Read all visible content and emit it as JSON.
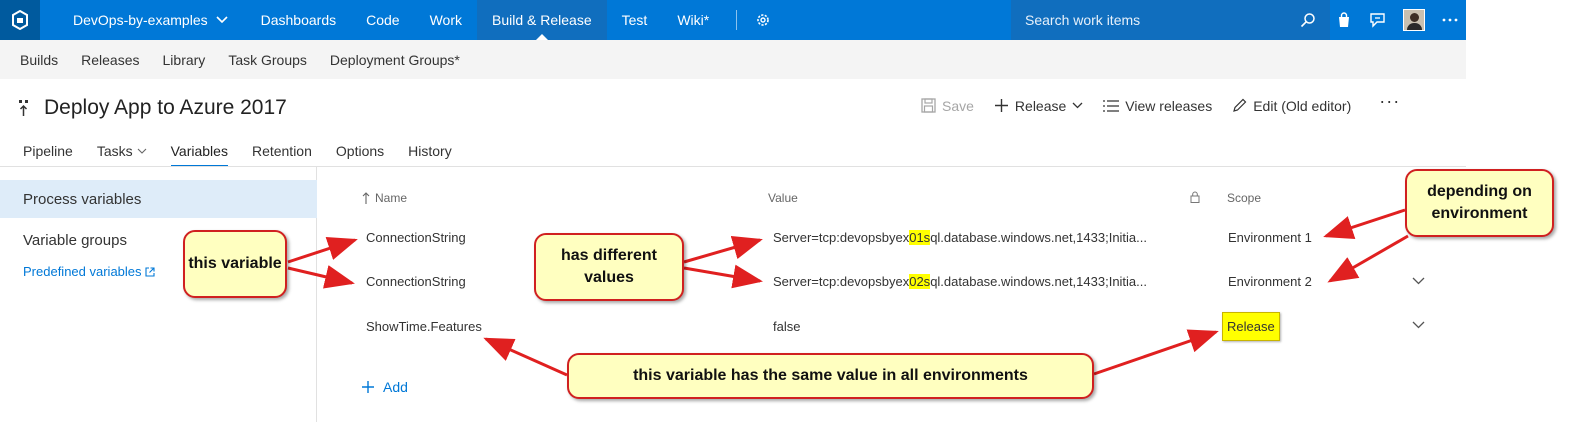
{
  "topbar": {
    "project": "DevOps-by-examples",
    "nav": [
      "Dashboards",
      "Code",
      "Work",
      "Build & Release",
      "Test",
      "Wiki*"
    ],
    "search_placeholder": "Search work items"
  },
  "subnav": [
    "Builds",
    "Releases",
    "Library",
    "Task Groups",
    "Deployment Groups*"
  ],
  "header": {
    "title": "Deploy App to Azure 2017",
    "save": "Save",
    "release": "Release",
    "view_releases": "View releases",
    "edit": "Edit (Old editor)",
    "more": "···"
  },
  "tabs": [
    "Pipeline",
    "Tasks",
    "Variables",
    "Retention",
    "Options",
    "History"
  ],
  "left": {
    "process_variables": "Process variables",
    "variable_groups": "Variable groups",
    "predefined": "Predefined variables"
  },
  "grid": {
    "col_name": "Name",
    "col_value": "Value",
    "col_scope": "Scope",
    "rows": [
      {
        "name": "ConnectionString",
        "value_pre": "Server=tcp:devopsbyex",
        "value_hl": "01s",
        "value_post": "ql.database.windows.net,1433;Initia...",
        "scope": "Environment 1"
      },
      {
        "name": "ConnectionString",
        "value_pre": "Server=tcp:devopsbyex",
        "value_hl": "02s",
        "value_post": "ql.database.windows.net,1433;Initia...",
        "scope": "Environment 2"
      },
      {
        "name": "ShowTime.Features",
        "value_pre": "false",
        "value_hl": "",
        "value_post": "",
        "scope": "Release"
      }
    ],
    "add": "Add"
  },
  "callouts": {
    "this_variable": "this variable",
    "different_values": "has different values",
    "depending": "depending on environment",
    "same_value": "this variable has the same value in all environments"
  },
  "colors": {
    "brand": "#0078d7",
    "highlight": "#ffff00",
    "callout_bg": "#ffffc0",
    "callout_border": "#d02020"
  }
}
